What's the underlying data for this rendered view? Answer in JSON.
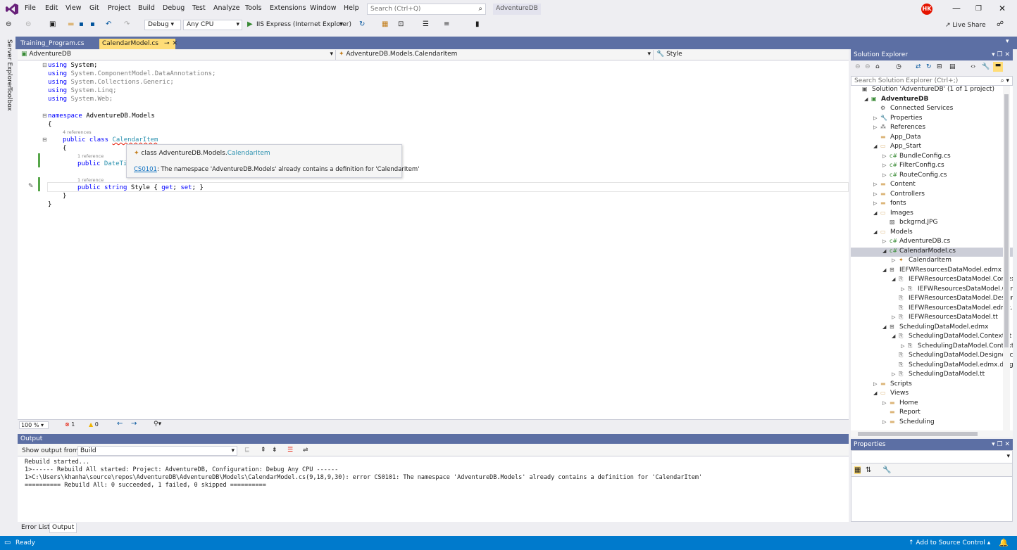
{
  "menubar": {
    "items": [
      "File",
      "Edit",
      "View",
      "Git",
      "Project",
      "Build",
      "Debug",
      "Test",
      "Analyze",
      "Tools",
      "Extensions",
      "Window",
      "Help"
    ],
    "search_placeholder": "Search (Ctrl+Q)",
    "solution_name": "AdventureDB",
    "user_initials": "HK"
  },
  "toolbar": {
    "configuration": "Debug",
    "platform": "Any CPU",
    "run_target": "IIS Express (Internet Explorer)",
    "live_share": "Live Share"
  },
  "side_tabs": [
    "Server Explorer",
    "Toolbox"
  ],
  "doc_tabs": [
    {
      "label": "Training_Program.cs"
    },
    {
      "label": "CalendarModel.cs"
    }
  ],
  "navbar": {
    "project": "AdventureDB",
    "type": "AdventureDB.Models.CalendarItem",
    "member": "Style"
  },
  "code": {
    "lines": [
      {
        "kw": "using",
        "rest": " System;"
      },
      {
        "kw": "using",
        "rest": " System.ComponentModel.DataAnnotations;"
      },
      {
        "kw": "using",
        "rest": " System.Collections.Generic;"
      },
      {
        "kw": "using",
        "rest": " System.Linq;"
      },
      {
        "kw": "using",
        "rest": " System.Web;"
      }
    ],
    "namespace_kw": "namespace",
    "namespace_name": " AdventureDB.Models",
    "open_brace": "{",
    "close_brace": "}",
    "refs_4": "4 references",
    "refs_1a": "1 reference",
    "refs_1b": "1 reference",
    "class_kw": "public class",
    "class_name": "CalendarItem",
    "prop1_kw": "public",
    "prop1_rest": " DateTi",
    "prop2_kw1": "public",
    "prop2_kw2": "string",
    "prop2_name": " Style { ",
    "prop2_get": "get",
    "prop2_set": "set",
    "prop2_end": "; }"
  },
  "tooltip": {
    "prefix": "class AdventureDB.Models.",
    "class_name": "CalendarItem",
    "error_code": "CS0101",
    "error_msg": ": The namespace 'AdventureDB.Models' already contains a definition for 'CalendarItem'"
  },
  "editor_status": {
    "zoom": "100 %",
    "errors": "1",
    "warnings": "0"
  },
  "output": {
    "title": "Output",
    "show_from_label": "Show output from:",
    "source": "Build",
    "lines": [
      "Rebuild started...",
      "1>------ Rebuild All started: Project: AdventureDB, Configuration: Debug Any CPU ------",
      "1>C:\\Users\\khanha\\source\\repos\\AdventureDB\\AdventureDB\\Models\\CalendarModel.cs(9,18,9,30): error CS0101: The namespace 'AdventureDB.Models' already contains a definition for 'CalendarItem'",
      "========== Rebuild All: 0 succeeded, 1 failed, 0 skipped =========="
    ]
  },
  "bottom_tabs": [
    "Error List",
    "Output"
  ],
  "statusbar": {
    "ready": "Ready",
    "source_control": "Add to Source Control"
  },
  "solution_explorer": {
    "title": "Solution Explorer",
    "search_placeholder": "Search Solution Explorer (Ctrl+;)",
    "items": [
      {
        "label": "Solution 'AdventureDB' (1 of 1 project)",
        "indent": 0,
        "arrow": "",
        "icon": "solution"
      },
      {
        "label": "AdventureDB",
        "indent": 1,
        "arrow": "open",
        "icon": "project",
        "bold": true
      },
      {
        "label": "Connected Services",
        "indent": 2,
        "arrow": "",
        "icon": "services"
      },
      {
        "label": "Properties",
        "indent": 2,
        "arrow": "closed",
        "icon": "wrench"
      },
      {
        "label": "References",
        "indent": 2,
        "arrow": "closed",
        "icon": "refs"
      },
      {
        "label": "App_Data",
        "indent": 2,
        "arrow": "",
        "icon": "folder"
      },
      {
        "label": "App_Start",
        "indent": 2,
        "arrow": "open",
        "icon": "folder-open"
      },
      {
        "label": "BundleConfig.cs",
        "indent": 3,
        "arrow": "closed",
        "icon": "cs"
      },
      {
        "label": "FilterConfig.cs",
        "indent": 3,
        "arrow": "closed",
        "icon": "cs"
      },
      {
        "label": "RouteConfig.cs",
        "indent": 3,
        "arrow": "closed",
        "icon": "cs"
      },
      {
        "label": "Content",
        "indent": 2,
        "arrow": "closed",
        "icon": "folder"
      },
      {
        "label": "Controllers",
        "indent": 2,
        "arrow": "closed",
        "icon": "folder"
      },
      {
        "label": "fonts",
        "indent": 2,
        "arrow": "closed",
        "icon": "folder"
      },
      {
        "label": "Images",
        "indent": 2,
        "arrow": "open",
        "icon": "folder-open"
      },
      {
        "label": "bckgrnd.JPG",
        "indent": 3,
        "arrow": "",
        "icon": "image"
      },
      {
        "label": "Models",
        "indent": 2,
        "arrow": "open",
        "icon": "folder-open"
      },
      {
        "label": "AdventureDB.cs",
        "indent": 3,
        "arrow": "closed",
        "icon": "cs"
      },
      {
        "label": "CalendarModel.cs",
        "indent": 3,
        "arrow": "open",
        "icon": "cs",
        "selected": true
      },
      {
        "label": "CalendarItem",
        "indent": 4,
        "arrow": "closed",
        "icon": "class"
      },
      {
        "label": "IEFWResourcesDataModel.edmx",
        "indent": 3,
        "arrow": "open",
        "icon": "edmx"
      },
      {
        "label": "IEFWResourcesDataModel.Contex",
        "indent": 4,
        "arrow": "open",
        "icon": "tt"
      },
      {
        "label": "IEFWResourcesDataModel.Cor",
        "indent": 5,
        "arrow": "closed",
        "icon": "tt"
      },
      {
        "label": "IEFWResourcesDataModel.Design",
        "indent": 4,
        "arrow": "",
        "icon": "tt"
      },
      {
        "label": "IEFWResourcesDataModel.edmx.c",
        "indent": 4,
        "arrow": "",
        "icon": "tt"
      },
      {
        "label": "IEFWResourcesDataModel.tt",
        "indent": 4,
        "arrow": "closed",
        "icon": "tt"
      },
      {
        "label": "SchedulingDataModel.edmx",
        "indent": 3,
        "arrow": "open",
        "icon": "edmx"
      },
      {
        "label": "SchedulingDataModel.Context.tt",
        "indent": 4,
        "arrow": "open",
        "icon": "tt"
      },
      {
        "label": "SchedulingDataModel.Context",
        "indent": 5,
        "arrow": "closed",
        "icon": "tt"
      },
      {
        "label": "SchedulingDataModel.Designer.cs",
        "indent": 4,
        "arrow": "",
        "icon": "tt"
      },
      {
        "label": "SchedulingDataModel.edmx.diag",
        "indent": 4,
        "arrow": "",
        "icon": "tt"
      },
      {
        "label": "SchedulingDataModel.tt",
        "indent": 4,
        "arrow": "closed",
        "icon": "tt"
      },
      {
        "label": "Scripts",
        "indent": 2,
        "arrow": "closed",
        "icon": "folder"
      },
      {
        "label": "Views",
        "indent": 2,
        "arrow": "open",
        "icon": "folder-open"
      },
      {
        "label": "Home",
        "indent": 3,
        "arrow": "closed",
        "icon": "folder"
      },
      {
        "label": "Report",
        "indent": 3,
        "arrow": "",
        "icon": "folder"
      },
      {
        "label": "Scheduling",
        "indent": 3,
        "arrow": "closed",
        "icon": "folder"
      }
    ]
  },
  "properties": {
    "title": "Properties"
  },
  "colors": {
    "accent": "#007acc",
    "tool_header": "#5c6fa4",
    "active_tab": "#ffdd77",
    "keyword": "#0000ff",
    "type": "#2b91af"
  }
}
